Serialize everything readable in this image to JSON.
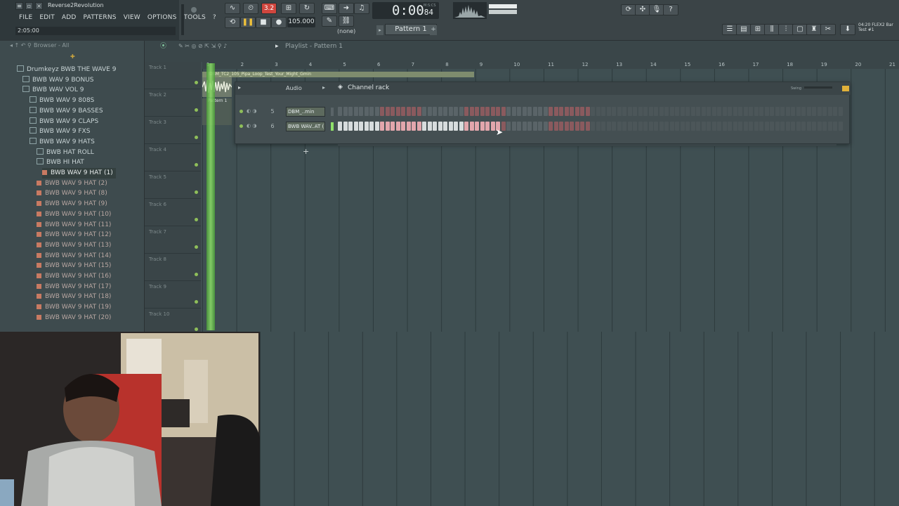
{
  "app": {
    "title": "Reverse2Revolution"
  },
  "menu": [
    "FILE",
    "EDIT",
    "ADD",
    "PATTERNS",
    "VIEW",
    "OPTIONS",
    "TOOLS",
    "?"
  ],
  "transport": {
    "song_time": "2:05:00",
    "counter": "3.2",
    "bpm": "105.000",
    "clock_main": "0:00",
    "clock_small": "84",
    "clock_label": "M:S:CS",
    "pattern": "Pattern 1",
    "none_label": "(none)"
  },
  "flex_info": {
    "line1": "04:20  FLEX2 Bar",
    "line2": "Test #1"
  },
  "browser": {
    "header": "Browser - All",
    "items": [
      {
        "label": "Drumkeyz BWB THE WAVE 9",
        "type": "folder",
        "indent": 24
      },
      {
        "label": "BWB WAV 9 BONUS",
        "type": "folder",
        "indent": 32
      },
      {
        "label": "BWB WAV VOL 9",
        "type": "folder",
        "indent": 32
      },
      {
        "label": "BWB WAV 9 808S",
        "type": "folder",
        "indent": 42
      },
      {
        "label": "BWB WAV 9 BASSES",
        "type": "folder",
        "indent": 42
      },
      {
        "label": "BWB WAV 9 CLAPS",
        "type": "folder",
        "indent": 42
      },
      {
        "label": "BWB WAV 9 FXS",
        "type": "folder",
        "indent": 42
      },
      {
        "label": "BWB WAV 9 HATS",
        "type": "folder",
        "indent": 42
      },
      {
        "label": "BWB HAT ROLL",
        "type": "folder",
        "indent": 52
      },
      {
        "label": "BWB HI HAT",
        "type": "folder",
        "indent": 52
      },
      {
        "label": "BWB WAV 9 HAT (1)",
        "type": "file",
        "indent": 60,
        "selected": true
      },
      {
        "label": "BWB WAV 9 HAT (2)",
        "type": "file",
        "indent": 52
      },
      {
        "label": "BWB WAV 9 HAT (8)",
        "type": "file",
        "indent": 52
      },
      {
        "label": "BWB WAV 9 HAT (9)",
        "type": "file",
        "indent": 52
      },
      {
        "label": "BWB WAV 9 HAT (10)",
        "type": "file",
        "indent": 52
      },
      {
        "label": "BWB WAV 9 HAT (11)",
        "type": "file",
        "indent": 52
      },
      {
        "label": "BWB WAV 9 HAT (12)",
        "type": "file",
        "indent": 52
      },
      {
        "label": "BWB WAV 9 HAT (13)",
        "type": "file",
        "indent": 52
      },
      {
        "label": "BWB WAV 9 HAT (14)",
        "type": "file",
        "indent": 52
      },
      {
        "label": "BWB WAV 9 HAT (15)",
        "type": "file",
        "indent": 52
      },
      {
        "label": "BWB WAV 9 HAT (16)",
        "type": "file",
        "indent": 52
      },
      {
        "label": "BWB WAV 9 HAT (17)",
        "type": "file",
        "indent": 52
      },
      {
        "label": "BWB WAV 9 HAT (18)",
        "type": "file",
        "indent": 52
      },
      {
        "label": "BWB WAV 9 HAT (19)",
        "type": "file",
        "indent": 52
      },
      {
        "label": "BWB WAV 9 HAT (20)",
        "type": "file",
        "indent": 52
      }
    ]
  },
  "playlist": {
    "title": "Playlist - Pattern 1",
    "tracks": [
      "Track 1",
      "Track 2",
      "Track 3",
      "Track 4",
      "Track 5",
      "Track 6",
      "Track 7",
      "Track 8",
      "Track 9",
      "Track 10"
    ],
    "bars": [
      "1",
      "2",
      "3",
      "4",
      "5",
      "6",
      "7",
      "8",
      "9",
      "10",
      "11",
      "12",
      "13",
      "14",
      "15",
      "16",
      "17",
      "18",
      "19",
      "20",
      "21"
    ],
    "clip_audio": "DBM_TC2_105_Pipa_Loop_Test_Your_Might_Gmin",
    "clip_pattern": "Pattern 1"
  },
  "channel_rack": {
    "title": "Channel rack",
    "filter": "Audio",
    "swing": "Swing",
    "add": "+",
    "channels": [
      {
        "number": "5",
        "name": "DBM_..min",
        "active_steps": []
      },
      {
        "number": "6",
        "name": "BWB WAV..AT (1)",
        "active_steps": [
          0,
          1,
          2,
          3,
          4,
          5,
          6,
          7,
          8,
          9,
          10,
          11,
          12,
          13,
          14,
          15,
          16,
          17,
          18,
          19,
          20,
          21,
          22,
          23,
          24,
          25,
          26,
          27,
          28,
          29,
          30
        ]
      }
    ],
    "step_count": 96,
    "red_groups": [
      [
        8,
        15
      ],
      [
        24,
        31
      ],
      [
        40,
        47
      ],
      [
        56,
        63
      ]
    ]
  },
  "colors": {
    "accent_green": "#8fe06a",
    "step_on": "#d7dcdd",
    "step_red": "#8a5a5e"
  }
}
